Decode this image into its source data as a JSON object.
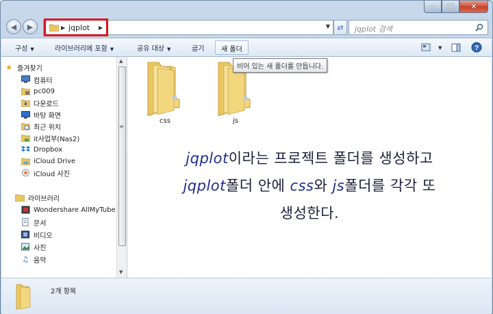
{
  "window": {
    "caption_buttons": [
      "minimize",
      "maximize",
      "close"
    ]
  },
  "address_bar": {
    "path": "jqplot",
    "highlight_color": "#e0101e"
  },
  "search": {
    "placeholder": "jqplot 검색"
  },
  "toolbar": {
    "organize": "구성",
    "include_in_library": "라이브러리에 포함",
    "share_with": "공유 대상",
    "burn": "굽기",
    "new_folder": "새 폴더"
  },
  "tooltip": {
    "text": "비어 있는 새 폴더를 만듭니다."
  },
  "sidebar": {
    "favorites_label": "즐겨찾기",
    "items": [
      {
        "label": "컴퓨터",
        "icon": "computer-icon"
      },
      {
        "label": "pc009",
        "icon": "folder-icon"
      },
      {
        "label": "다운로드",
        "icon": "downloads-icon"
      },
      {
        "label": "바탕 화면",
        "icon": "desktop-icon"
      },
      {
        "label": "최근 위치",
        "icon": "recent-places-icon"
      },
      {
        "label": "it사업부(Nas2)",
        "icon": "network-drive-icon"
      },
      {
        "label": "Dropbox",
        "icon": "dropbox-icon"
      },
      {
        "label": "iCloud Drive",
        "icon": "icloud-drive-icon"
      },
      {
        "label": "iCloud 사진",
        "icon": "icloud-photos-icon"
      }
    ],
    "libraries_label": "라이브러리",
    "library_items": [
      {
        "label": "Wondershare AllMyTube",
        "icon": "video-library-icon"
      },
      {
        "label": "문서",
        "icon": "documents-icon"
      },
      {
        "label": "비디오",
        "icon": "videos-icon"
      },
      {
        "label": "사진",
        "icon": "pictures-icon"
      },
      {
        "label": "음악",
        "icon": "music-icon"
      }
    ]
  },
  "files": [
    {
      "name": "css"
    },
    {
      "name": "js"
    }
  ],
  "annotation": {
    "line1_kw": "jqplot",
    "line1_rest": "이라는 프로젝트 폴더를 생성하고",
    "line2_kw1": "jqplot",
    "line2_mid1": "폴더 안에 ",
    "line2_kw2": "css",
    "line2_mid2": "와 ",
    "line2_kw3": "js",
    "line2_rest": "폴더를 각각 또",
    "line3": "생성한다."
  },
  "details": {
    "count": "2개 항목"
  }
}
